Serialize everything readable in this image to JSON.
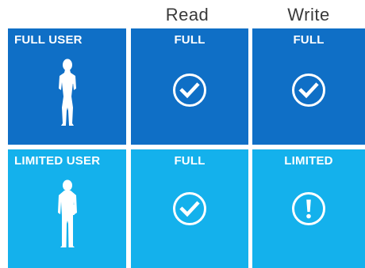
{
  "headers": {
    "read": "Read",
    "write": "Write"
  },
  "rows": [
    {
      "user": {
        "label": "FULL USER",
        "icon": "woman-silhouette-icon"
      },
      "read": {
        "label": "FULL",
        "icon": "checkmark-circle-icon"
      },
      "write": {
        "label": "FULL",
        "icon": "checkmark-circle-icon"
      }
    },
    {
      "user": {
        "label": "LIMITED USER",
        "icon": "man-silhouette-icon"
      },
      "read": {
        "label": "FULL",
        "icon": "checkmark-circle-icon"
      },
      "write": {
        "label": "LIMITED",
        "icon": "exclamation-circle-icon"
      }
    }
  ],
  "colors": {
    "full_user_row": "#0f6fc6",
    "limited_user_row": "#14b1ec",
    "header_text": "#3a3a3a",
    "icon": "#ffffff"
  }
}
